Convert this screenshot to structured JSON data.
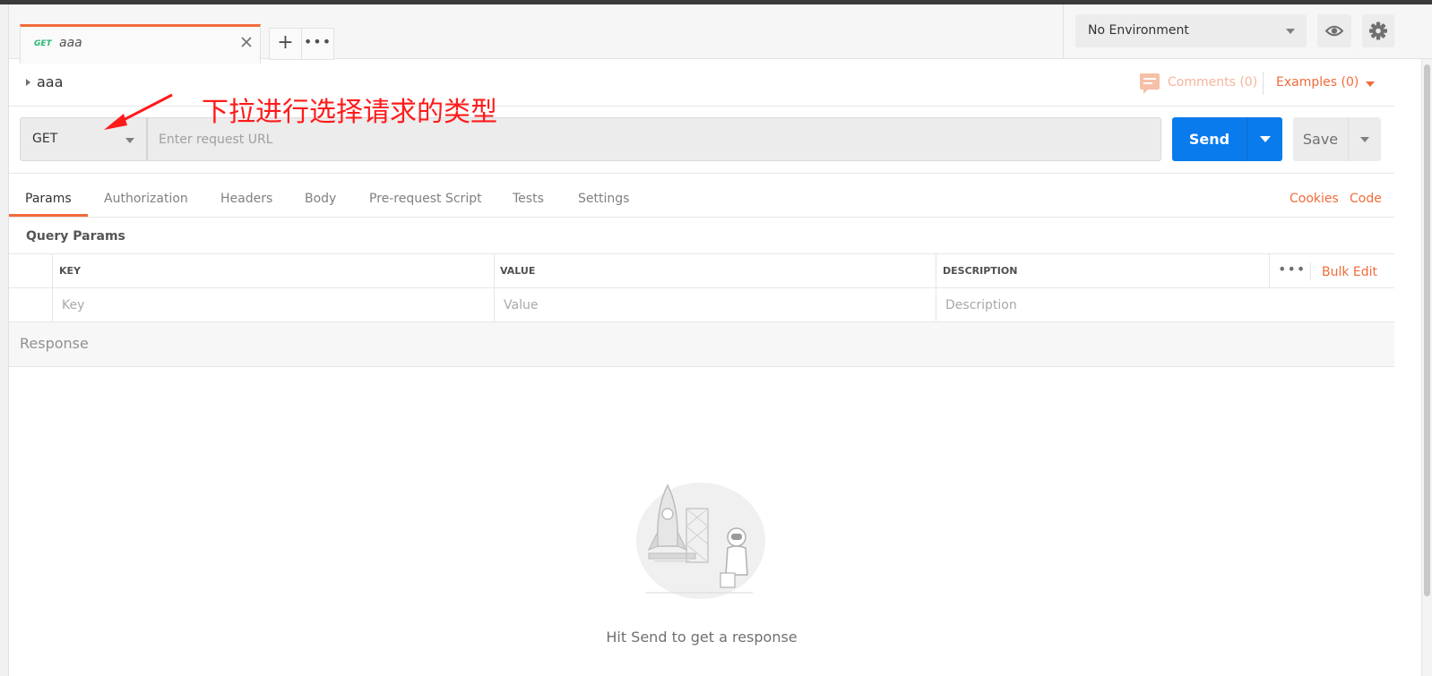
{
  "tab": {
    "method": "GET",
    "title": "aaa",
    "close_icon": "close-icon"
  },
  "new_tab": {
    "label": "+"
  },
  "more_tabs": {
    "label": "•••"
  },
  "environment": {
    "selected": "No Environment"
  },
  "request": {
    "name": "aaa"
  },
  "comments": {
    "label": "Comments (0)"
  },
  "examples": {
    "label": "Examples (0)"
  },
  "annotation": {
    "text": "下拉进行选择请求的类型",
    "color": "#ff1a1a"
  },
  "url_bar": {
    "method": "GET",
    "url_value": "",
    "placeholder": "Enter request URL"
  },
  "buttons": {
    "send": "Send",
    "save": "Save"
  },
  "sub_tabs": [
    "Params",
    "Authorization",
    "Headers",
    "Body",
    "Pre-request Script",
    "Tests",
    "Settings"
  ],
  "links": {
    "cookies": "Cookies",
    "code": "Code"
  },
  "params": {
    "title": "Query Params",
    "headers": [
      "KEY",
      "VALUE",
      "DESCRIPTION"
    ],
    "placeholders": {
      "key": "Key",
      "value": "Value",
      "description": "Description"
    },
    "more": "•••",
    "bulk_edit": "Bulk Edit"
  },
  "response": {
    "title": "Response",
    "hint": "Hit Send to get a response"
  },
  "colors": {
    "accent": "#f26b3a",
    "primary": "#097bed",
    "get_method": "#2bb673"
  }
}
